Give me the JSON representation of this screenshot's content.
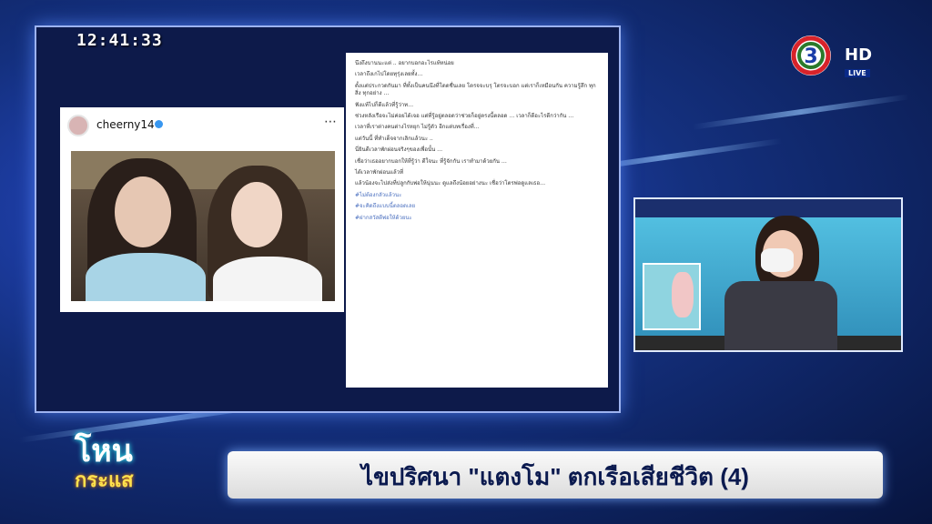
{
  "broadcast": {
    "clock": "12:41:33",
    "channel_hd": "HD",
    "live_label": "LIVE",
    "show_title_top": "โหน",
    "show_title_bottom": "กระแส",
    "headline": "ไขปริศนา \"แตงโม\" ตกเรือเสียชีวิต (4)"
  },
  "instagram": {
    "username": "cheerny14",
    "more_icon": "more-icon",
    "caption": [
      "นึงถึงบานนะแต่ .. อยากบอกอะไรแท้หน่อย",
      "เวลาถึงเกไปโดยทุรุ่งเลยทั้ง…",
      "ตั้งแต่ประกวดกันมา ที่ทั้งเป็นคนนึงที่โดดชื่นเลย โตรจจะบรุ โตรจะบอก แต่เราก็เหมือนกัน ความรู้สึก ทุกสิ่ง ทุกอย่าง …",
      "ฟังแท้ไปก็ดีแล้วที่รู้ว่าท…",
      "ช่วงหลังเรือจะไม่ค่อยได้เจอ แต่ที่รู้อยู่ตลอดว่าช่วยก็อยู่ตรงนี้ตลอด … เวลาก็ดีอะไรดีกว่ากัน …",
      "เวลาที่เราต่างคนต่างไรหยุก ไม่รู้ตัว อีกแต่บทเรื่องที่…",
      "แต่วันนี้ ที่ทำเด็จจากเลิกแล้วนะ ..",
      "นี่ยินดีเวลาพักผ่อนจริงๆของเพื่อนั้น …",
      "เชื่อว่าเธออยากบอกให้ที่รู้ว่า ดีใจนะ ที่รู้จักกัน เราทำมาด้วยกัน …",
      "ได้เวลาพักผ่อนแล้วที่",
      "แล้วน้องจะไปส่งที่ปลูกกับพ่อให้นุ่นนะ ดูแลถึงน้อยอย่างนะ เชื่อว่าโตรพ่อดูแลเธอ…",
      "#ไม่ต้องกลัวแล้วนะ",
      "#จะคิดถึงแบบนี้ตลอดเลย",
      "#ฝากสวัสดีพ่อให้ด้วยนะ"
    ]
  },
  "colors": {
    "accent": "#0b1a4f",
    "hashtag": "#4a6fbf"
  }
}
